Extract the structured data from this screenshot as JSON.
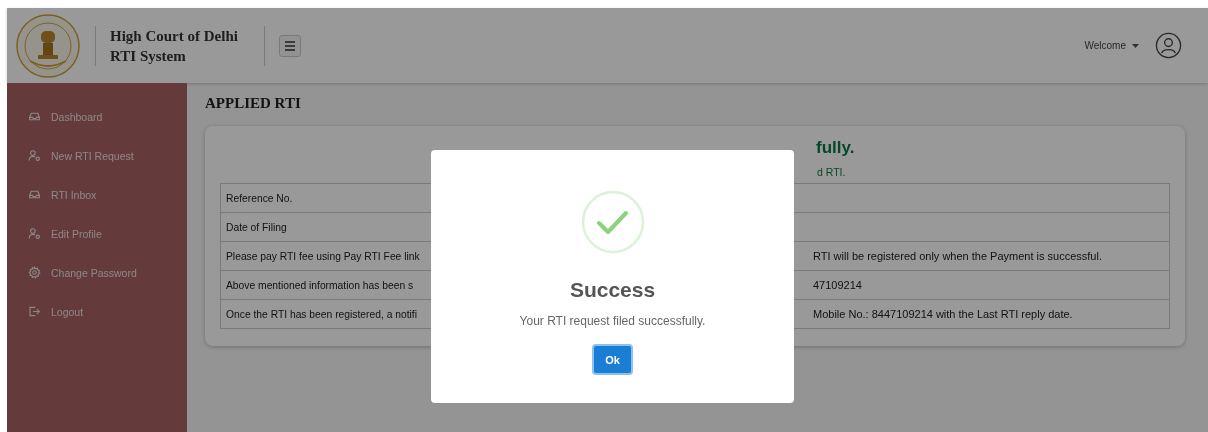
{
  "header": {
    "title_lines": [
      "High Court of Delhi",
      "RTI System"
    ],
    "user_menu": "Welcome"
  },
  "sidebar": {
    "items": [
      {
        "label": "Dashboard",
        "kind": "inbox"
      },
      {
        "label": "New RTI Request",
        "kind": "user"
      },
      {
        "label": "RTI Inbox",
        "kind": "inbox"
      },
      {
        "label": "Edit Profile",
        "kind": "user"
      },
      {
        "label": "Change Password",
        "kind": "gear"
      },
      {
        "label": "Logout",
        "kind": "logout"
      }
    ]
  },
  "page_title": "APPLIED RTI",
  "card": {
    "heading": "fully.",
    "subline": "d RTI.",
    "rows": [
      {
        "column_1": "Reference No."
      },
      {
        "column_1": "Date of Filing"
      },
      {
        "column_1": "Please pay RTI fee using Pay RTI Fee link",
        "column_3": "RTI will be registered only when the Payment is successful."
      },
      {
        "column_1": "Above mentioned information has been s",
        "column_3": "47109214"
      },
      {
        "column_1": "Once the RTI has been registered, a notifi",
        "column_3": "Mobile No.: 8447109214 with the Last RTI reply date."
      }
    ]
  },
  "modal": {
    "title": "Success",
    "message": "Your RTI request filed successfully.",
    "button": "Ok"
  }
}
